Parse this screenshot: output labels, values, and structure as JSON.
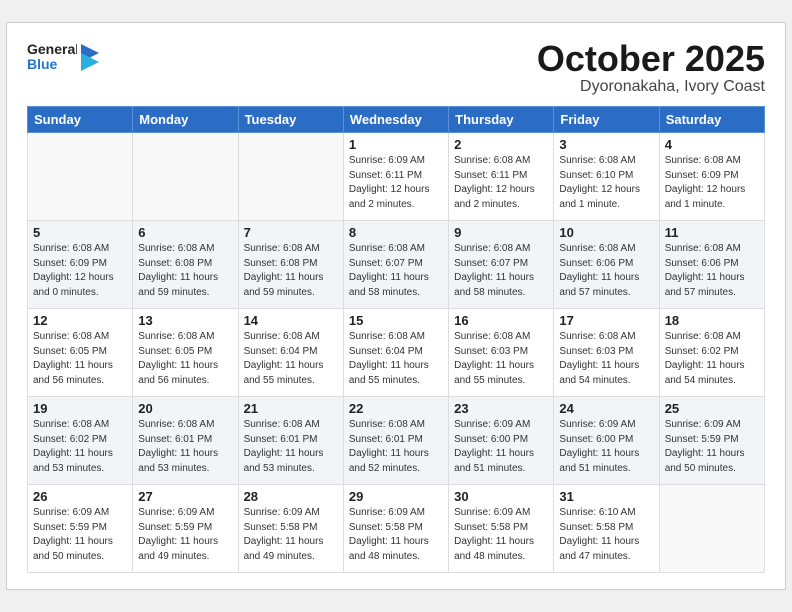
{
  "header": {
    "logo_general": "General",
    "logo_blue": "Blue",
    "month": "October 2025",
    "location": "Dyoronakaha, Ivory Coast"
  },
  "weekdays": [
    "Sunday",
    "Monday",
    "Tuesday",
    "Wednesday",
    "Thursday",
    "Friday",
    "Saturday"
  ],
  "weeks": [
    [
      {
        "day": "",
        "info": ""
      },
      {
        "day": "",
        "info": ""
      },
      {
        "day": "",
        "info": ""
      },
      {
        "day": "1",
        "info": "Sunrise: 6:09 AM\nSunset: 6:11 PM\nDaylight: 12 hours\nand 2 minutes."
      },
      {
        "day": "2",
        "info": "Sunrise: 6:08 AM\nSunset: 6:11 PM\nDaylight: 12 hours\nand 2 minutes."
      },
      {
        "day": "3",
        "info": "Sunrise: 6:08 AM\nSunset: 6:10 PM\nDaylight: 12 hours\nand 1 minute."
      },
      {
        "day": "4",
        "info": "Sunrise: 6:08 AM\nSunset: 6:09 PM\nDaylight: 12 hours\nand 1 minute."
      }
    ],
    [
      {
        "day": "5",
        "info": "Sunrise: 6:08 AM\nSunset: 6:09 PM\nDaylight: 12 hours\nand 0 minutes."
      },
      {
        "day": "6",
        "info": "Sunrise: 6:08 AM\nSunset: 6:08 PM\nDaylight: 11 hours\nand 59 minutes."
      },
      {
        "day": "7",
        "info": "Sunrise: 6:08 AM\nSunset: 6:08 PM\nDaylight: 11 hours\nand 59 minutes."
      },
      {
        "day": "8",
        "info": "Sunrise: 6:08 AM\nSunset: 6:07 PM\nDaylight: 11 hours\nand 58 minutes."
      },
      {
        "day": "9",
        "info": "Sunrise: 6:08 AM\nSunset: 6:07 PM\nDaylight: 11 hours\nand 58 minutes."
      },
      {
        "day": "10",
        "info": "Sunrise: 6:08 AM\nSunset: 6:06 PM\nDaylight: 11 hours\nand 57 minutes."
      },
      {
        "day": "11",
        "info": "Sunrise: 6:08 AM\nSunset: 6:06 PM\nDaylight: 11 hours\nand 57 minutes."
      }
    ],
    [
      {
        "day": "12",
        "info": "Sunrise: 6:08 AM\nSunset: 6:05 PM\nDaylight: 11 hours\nand 56 minutes."
      },
      {
        "day": "13",
        "info": "Sunrise: 6:08 AM\nSunset: 6:05 PM\nDaylight: 11 hours\nand 56 minutes."
      },
      {
        "day": "14",
        "info": "Sunrise: 6:08 AM\nSunset: 6:04 PM\nDaylight: 11 hours\nand 55 minutes."
      },
      {
        "day": "15",
        "info": "Sunrise: 6:08 AM\nSunset: 6:04 PM\nDaylight: 11 hours\nand 55 minutes."
      },
      {
        "day": "16",
        "info": "Sunrise: 6:08 AM\nSunset: 6:03 PM\nDaylight: 11 hours\nand 55 minutes."
      },
      {
        "day": "17",
        "info": "Sunrise: 6:08 AM\nSunset: 6:03 PM\nDaylight: 11 hours\nand 54 minutes."
      },
      {
        "day": "18",
        "info": "Sunrise: 6:08 AM\nSunset: 6:02 PM\nDaylight: 11 hours\nand 54 minutes."
      }
    ],
    [
      {
        "day": "19",
        "info": "Sunrise: 6:08 AM\nSunset: 6:02 PM\nDaylight: 11 hours\nand 53 minutes."
      },
      {
        "day": "20",
        "info": "Sunrise: 6:08 AM\nSunset: 6:01 PM\nDaylight: 11 hours\nand 53 minutes."
      },
      {
        "day": "21",
        "info": "Sunrise: 6:08 AM\nSunset: 6:01 PM\nDaylight: 11 hours\nand 53 minutes."
      },
      {
        "day": "22",
        "info": "Sunrise: 6:08 AM\nSunset: 6:01 PM\nDaylight: 11 hours\nand 52 minutes."
      },
      {
        "day": "23",
        "info": "Sunrise: 6:09 AM\nSunset: 6:00 PM\nDaylight: 11 hours\nand 51 minutes."
      },
      {
        "day": "24",
        "info": "Sunrise: 6:09 AM\nSunset: 6:00 PM\nDaylight: 11 hours\nand 51 minutes."
      },
      {
        "day": "25",
        "info": "Sunrise: 6:09 AM\nSunset: 5:59 PM\nDaylight: 11 hours\nand 50 minutes."
      }
    ],
    [
      {
        "day": "26",
        "info": "Sunrise: 6:09 AM\nSunset: 5:59 PM\nDaylight: 11 hours\nand 50 minutes."
      },
      {
        "day": "27",
        "info": "Sunrise: 6:09 AM\nSunset: 5:59 PM\nDaylight: 11 hours\nand 49 minutes."
      },
      {
        "day": "28",
        "info": "Sunrise: 6:09 AM\nSunset: 5:58 PM\nDaylight: 11 hours\nand 49 minutes."
      },
      {
        "day": "29",
        "info": "Sunrise: 6:09 AM\nSunset: 5:58 PM\nDaylight: 11 hours\nand 48 minutes."
      },
      {
        "day": "30",
        "info": "Sunrise: 6:09 AM\nSunset: 5:58 PM\nDaylight: 11 hours\nand 48 minutes."
      },
      {
        "day": "31",
        "info": "Sunrise: 6:10 AM\nSunset: 5:58 PM\nDaylight: 11 hours\nand 47 minutes."
      },
      {
        "day": "",
        "info": ""
      }
    ]
  ]
}
